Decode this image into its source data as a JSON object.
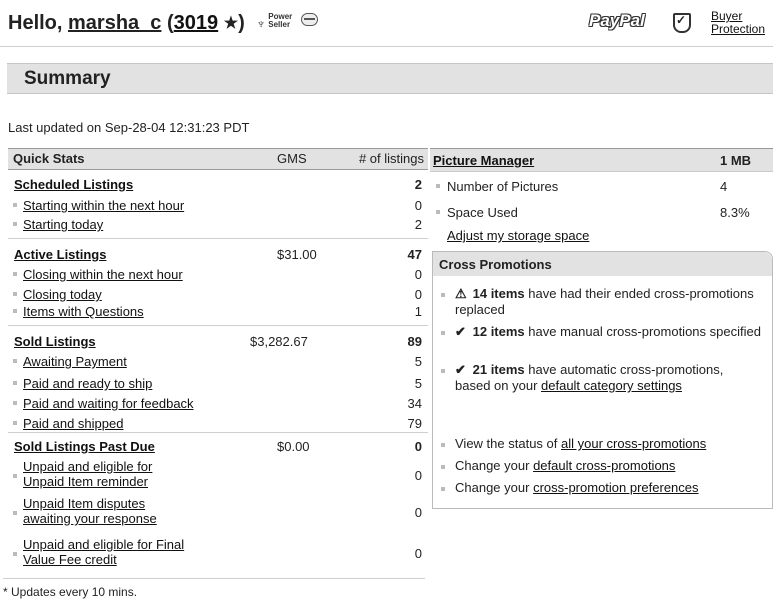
{
  "header": {
    "greeting": "Hello,",
    "username": "marsha_c",
    "feedback_score": "3019",
    "power_line1": "Power",
    "power_line2": "Seller",
    "paypal": "PayPal",
    "buyer_protection_line1": "Buyer",
    "buyer_protection_line2": "Protection"
  },
  "summary": {
    "title": "Summary",
    "last_updated": "Last updated on Sep-28-04 12:31:23 PDT"
  },
  "quick_stats": {
    "title": "Quick Stats",
    "gms_header": "GMS",
    "listings_header": "# of listings",
    "groups": [
      {
        "label": "Scheduled Listings",
        "gms": "",
        "count": "2",
        "items": [
          {
            "label": "Starting within the next hour",
            "count": "0"
          },
          {
            "label": "Starting today",
            "count": "2"
          }
        ]
      },
      {
        "label": "Active Listings",
        "gms": "$31.00",
        "count": "47",
        "items": [
          {
            "label": "Closing within the next hour",
            "count": "0"
          },
          {
            "label": "Closing today",
            "count": "0"
          },
          {
            "label": "Items with Questions",
            "count": "1"
          }
        ]
      },
      {
        "label": "Sold Listings",
        "gms": "$3,282.67",
        "count": "89",
        "items": [
          {
            "label": "Awaiting Payment",
            "count": "5"
          },
          {
            "label": "Paid and ready to ship",
            "count": "5"
          },
          {
            "label": "Paid and waiting for feedback",
            "count": "34"
          },
          {
            "label": "Paid and shipped",
            "count": "79"
          }
        ]
      },
      {
        "label": "Sold Listings Past Due",
        "gms": "$0.00",
        "count": "0",
        "items": [
          {
            "label1": "Unpaid and eligible for",
            "label2": "Unpaid Item reminder",
            "count": "0"
          },
          {
            "label1": "Unpaid Item disputes",
            "label2": "awaiting your response",
            "count": "0"
          },
          {
            "label1": "Unpaid and eligible for Final",
            "label2": "Value Fee credit",
            "count": "0"
          }
        ]
      }
    ],
    "footnote": "* Updates every 10 mins."
  },
  "picture_manager": {
    "title": "Picture Manager",
    "size": "1 MB",
    "number_label": "Number of Pictures",
    "number_value": "4",
    "space_label": "Space Used",
    "space_value": "8.3%",
    "adjust_link": "Adjust my storage space"
  },
  "cross_promotions": {
    "title": "Cross Promotions",
    "item1_count": "14 items",
    "item1_text": " have had their ended cross-promotions replaced",
    "item2_count": "12 items",
    "item2_text": " have manual cross-promotions specified",
    "item3_count": "21 items",
    "item3_text": " have automatic cross-promotions, based on your ",
    "item3_link": "default category settings",
    "link1_prefix": "View the status of ",
    "link1": "all your cross-promotions",
    "link2_prefix": "Change your ",
    "link2": "default cross-promotions",
    "link3_prefix": "Change your ",
    "link3": "cross-promotion preferences"
  }
}
